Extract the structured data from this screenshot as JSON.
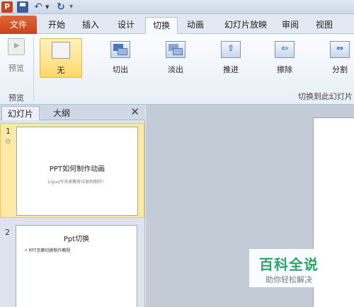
{
  "qat": {
    "app_letter": "P"
  },
  "tabs": [
    {
      "label": "文件"
    },
    {
      "label": "开始"
    },
    {
      "label": "插入"
    },
    {
      "label": "设计"
    },
    {
      "label": "切换"
    },
    {
      "label": "动画"
    },
    {
      "label": "幻灯片放映"
    },
    {
      "label": "审阅"
    },
    {
      "label": "视图"
    }
  ],
  "ribbon": {
    "preview_label": "预览",
    "preview_group": "预览",
    "transitions_group": "切换到此幻灯片",
    "transitions": [
      {
        "label": "无"
      },
      {
        "label": "切出"
      },
      {
        "label": "淡出"
      },
      {
        "label": "推进"
      },
      {
        "label": "擦除"
      },
      {
        "label": "分割"
      }
    ]
  },
  "pane": {
    "tab_slides": "幻灯片",
    "tab_outline": "大纲",
    "close": "✕",
    "slides": [
      {
        "num": "1",
        "star": "✩",
        "title": "PPT如何制作动画",
        "subtitle": "Liguq今天来教各位如何制作！"
      },
      {
        "num": "2",
        "title": "Ppt切换",
        "bullet": "• PPT页面切换制作教程"
      }
    ]
  },
  "watermark": {
    "title": "百科全说",
    "subtitle": "助你轻松解决"
  },
  "colors": {
    "file_tab": "#c9431a",
    "selected": "#ffd86a",
    "watermark": "#2aa56b"
  }
}
